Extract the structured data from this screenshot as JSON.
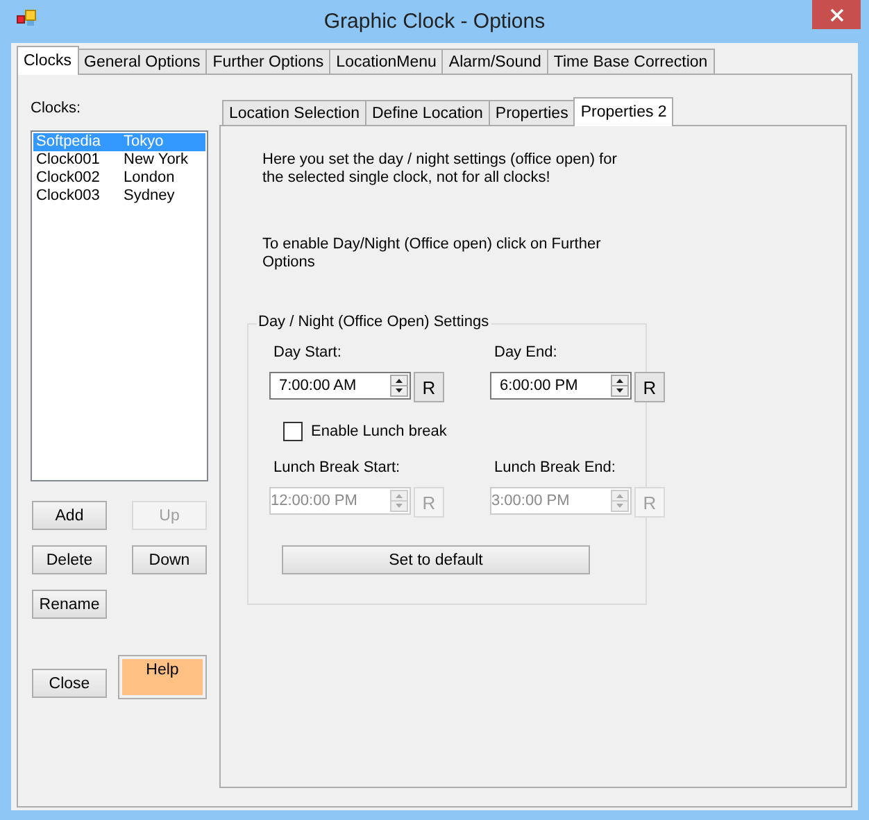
{
  "window": {
    "title": "Graphic Clock - Options"
  },
  "tabs": [
    {
      "label": "Clocks",
      "selected": true
    },
    {
      "label": "General Options",
      "selected": false
    },
    {
      "label": "Further Options",
      "selected": false
    },
    {
      "label": "LocationMenu",
      "selected": false
    },
    {
      "label": "Alarm/Sound",
      "selected": false
    },
    {
      "label": "Time Base Correction",
      "selected": false
    }
  ],
  "clocks": {
    "label": "Clocks:",
    "items": [
      {
        "name": "Softpedia",
        "city": "Tokyo",
        "selected": true
      },
      {
        "name": "Clock001",
        "city": "New York",
        "selected": false
      },
      {
        "name": "Clock002",
        "city": "London",
        "selected": false
      },
      {
        "name": "Clock003",
        "city": "Sydney",
        "selected": false
      }
    ],
    "button_rows": [
      [
        {
          "label": "Add",
          "disabled": false,
          "kind": "normal"
        },
        {
          "label": "Up",
          "disabled": true,
          "kind": "normal"
        }
      ],
      [
        {
          "label": "Delete",
          "disabled": false,
          "kind": "normal"
        },
        {
          "label": "Down",
          "disabled": false,
          "kind": "normal"
        }
      ],
      [
        {
          "label": "Rename",
          "disabled": false,
          "kind": "normal"
        }
      ],
      [
        {
          "label": "Close",
          "disabled": false,
          "kind": "normal"
        },
        {
          "label": "Help",
          "disabled": false,
          "kind": "highlight"
        }
      ]
    ]
  },
  "sub_tabs": [
    {
      "label": "Location Selection",
      "selected": false
    },
    {
      "label": "Define Location",
      "selected": false
    },
    {
      "label": "Properties",
      "selected": false
    },
    {
      "label": "Properties 2",
      "selected": true
    }
  ],
  "properties2": {
    "intro": "Here you set the day / night settings (office open) for the selected single clock, not for all clocks!",
    "hint": "To enable Day/Night (Office open) click on Further Options",
    "group": {
      "title": "Day / Night (Office Open) Settings",
      "day_row": [
        {
          "label": "Day Start:",
          "value": "7:00:00 AM",
          "reset": "R",
          "disabled": false
        },
        {
          "label": "Day End:",
          "value": "6:00:00 PM",
          "reset": "R",
          "disabled": false
        }
      ],
      "lunch_check": {
        "label": "Enable Lunch break",
        "checked": false
      },
      "lunch_row": [
        {
          "label": "Lunch Break Start:",
          "value": "12:00:00 PM",
          "reset": "R",
          "disabled": true
        },
        {
          "label": "Lunch Break End:",
          "value": "3:00:00 PM",
          "reset": "R",
          "disabled": true
        }
      ],
      "default_button": "Set to default"
    }
  }
}
